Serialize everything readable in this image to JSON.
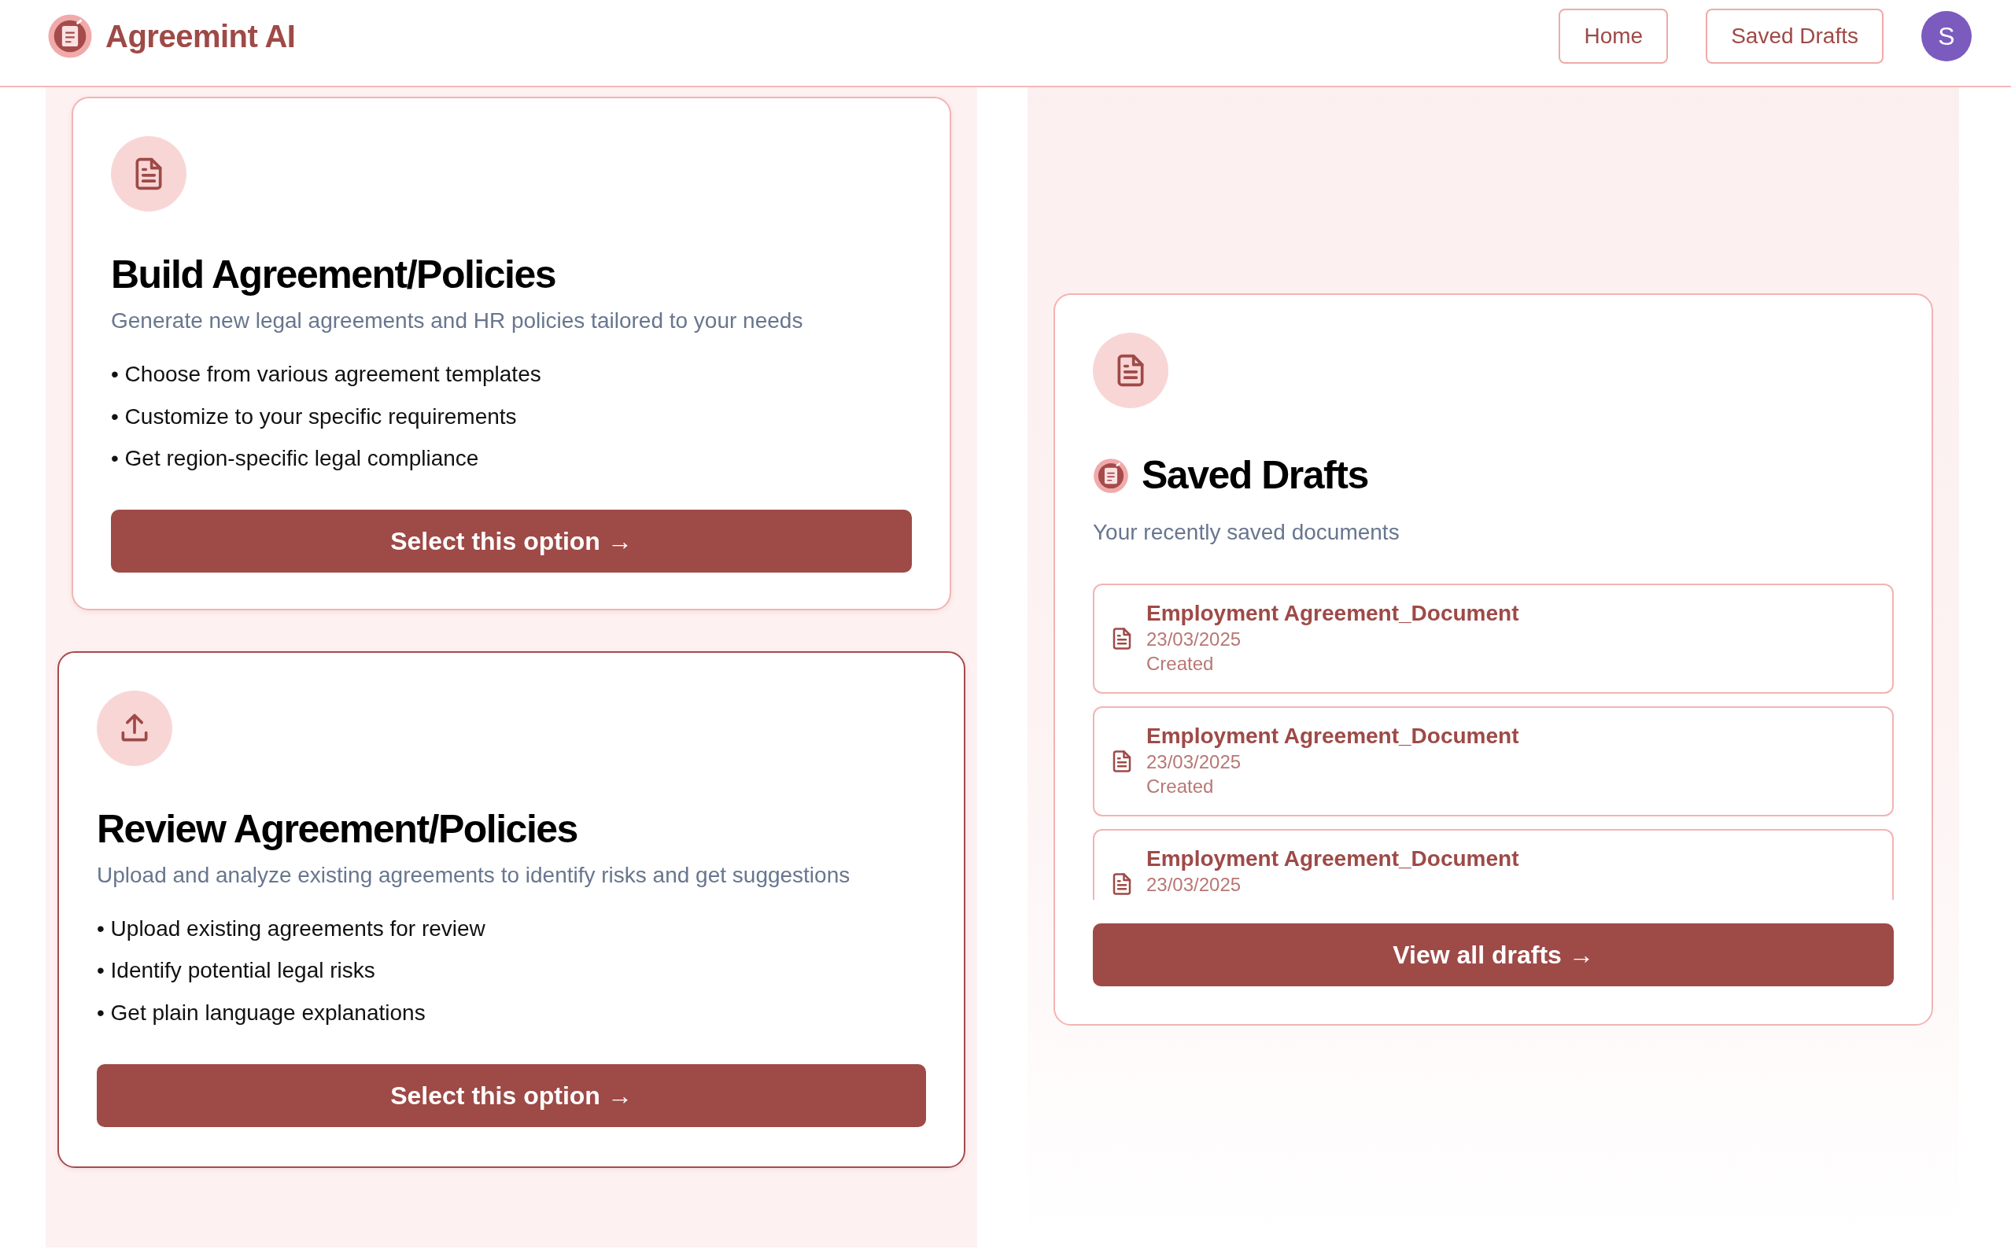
{
  "header": {
    "brand": "Agreemint AI",
    "nav": [
      {
        "label": "Home"
      },
      {
        "label": "Saved Drafts"
      }
    ],
    "avatar": "S"
  },
  "options": [
    {
      "kind": "build",
      "title": "Build Agreement/Policies",
      "subtitle": "Generate new legal agreements and HR policies tailored to your needs",
      "features": [
        "• Choose from various agreement templates",
        "• Customize to your specific requirements",
        "• Get region-specific legal compliance"
      ],
      "button": "Select this option →",
      "highlighted": false
    },
    {
      "kind": "review",
      "title": "Review Agreement/Policies",
      "subtitle": "Upload and analyze existing agreements to identify risks and get suggestions",
      "features": [
        "• Upload existing agreements for review",
        "• Identify potential legal risks",
        "• Get plain language explanations"
      ],
      "button": "Select this option →",
      "highlighted": true
    }
  ],
  "drafts_panel": {
    "title": "Saved Drafts",
    "subtitle": "Your recently saved documents",
    "drafts": [
      {
        "name": "Employment Agreement_Document",
        "date": "23/03/2025",
        "status": "Created"
      },
      {
        "name": "Employment Agreement_Document",
        "date": "23/03/2025",
        "status": "Created"
      },
      {
        "name": "Employment Agreement_Document",
        "date": "23/03/2025"
      }
    ],
    "button": "View all drafts →"
  }
}
